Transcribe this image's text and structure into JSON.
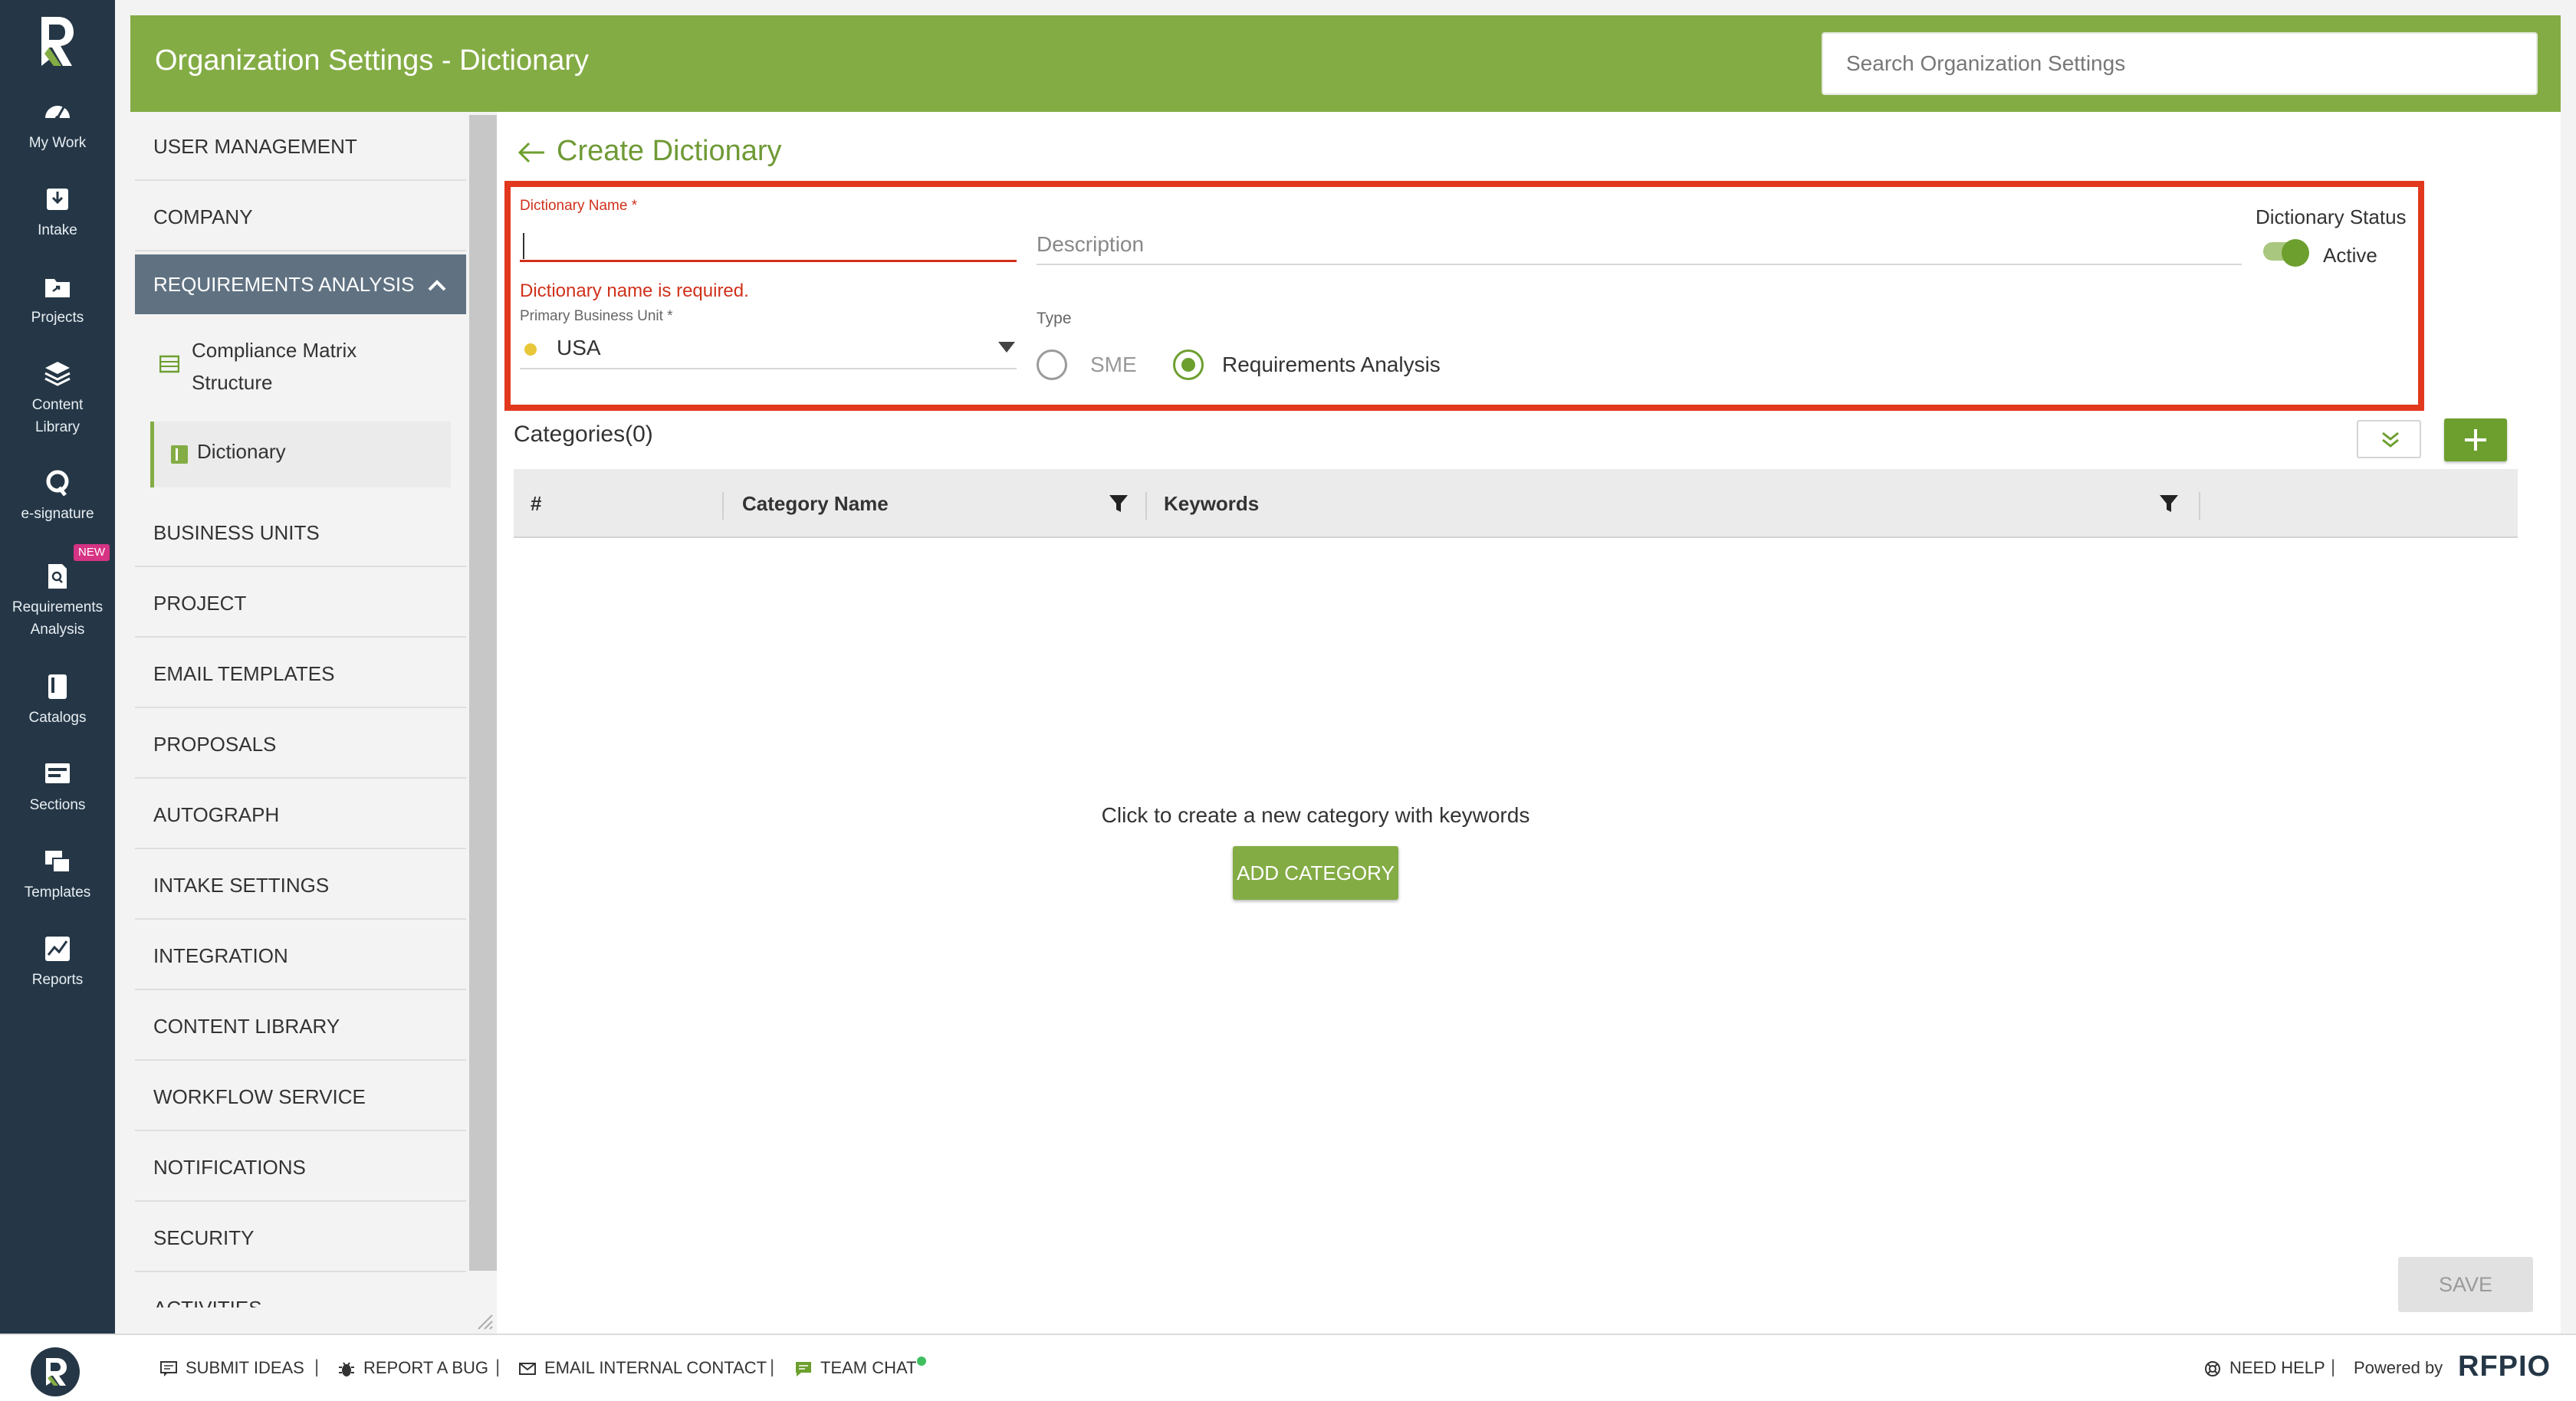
{
  "colors": {
    "nav_bg": "#253746",
    "header_bg": "#84ac45",
    "accent": "#6d9f2f",
    "error": "#d0311b",
    "highlight_border": "#e2381e",
    "badge": "#d63384"
  },
  "leftnav": {
    "items": [
      {
        "label": "My Work",
        "icon": "dashboard-icon"
      },
      {
        "label": "Intake",
        "icon": "download-tray-icon"
      },
      {
        "label": "Projects",
        "icon": "folder-icon"
      },
      {
        "label_line1": "Content",
        "label_line2": "Library",
        "icon": "layers-icon"
      },
      {
        "label": "e-signature",
        "icon": "signature-icon"
      },
      {
        "label_line1": "Requirements",
        "label_line2": "Analysis",
        "icon": "document-search-icon",
        "badge": "NEW"
      },
      {
        "label": "Catalogs",
        "icon": "book-icon"
      },
      {
        "label": "Sections",
        "icon": "sections-icon"
      },
      {
        "label": "Templates",
        "icon": "templates-icon"
      },
      {
        "label": "Reports",
        "icon": "chart-icon"
      }
    ]
  },
  "header": {
    "title": "Organization Settings - Dictionary",
    "search_placeholder": "Search Organization Settings"
  },
  "menu": {
    "items": [
      "USER MANAGEMENT",
      "COMPANY",
      "REQUIREMENTS ANALYSIS",
      "BUSINESS UNITS",
      "PROJECT",
      "EMAIL TEMPLATES",
      "PROPOSALS",
      "AUTOGRAPH",
      "INTAKE SETTINGS",
      "INTEGRATION",
      "CONTENT LIBRARY",
      "WORKFLOW SERVICE",
      "NOTIFICATIONS",
      "SECURITY",
      "ACTIVITIES"
    ],
    "sub_items": [
      {
        "line1": "Compliance Matrix",
        "line2": "Structure"
      },
      {
        "line1": "Dictionary"
      }
    ]
  },
  "form": {
    "back_label": "Create Dictionary",
    "name_label": "Dictionary Name",
    "name_value": "",
    "name_error": "Dictionary name is required.",
    "description_placeholder": "Description",
    "status_label": "Dictionary Status",
    "status_value": "Active",
    "status_on": true,
    "bu_label": "Primary Business Unit",
    "bu_value": "USA",
    "type_label": "Type",
    "type_options": [
      "SME",
      "Requirements Analysis"
    ],
    "type_selected": "Requirements Analysis",
    "required_mark": "*"
  },
  "categories": {
    "title": "Categories(0)",
    "columns": [
      "#",
      "Category Name",
      "Keywords"
    ],
    "rows": [],
    "empty_text": "Click to create a new category with keywords",
    "add_label": "ADD CATEGORY"
  },
  "save_label": "SAVE",
  "footer": {
    "links": [
      "SUBMIT IDEAS",
      "REPORT A BUG",
      "EMAIL INTERNAL CONTACT",
      "TEAM CHAT",
      "NEED HELP"
    ],
    "separator": "|",
    "powered_by": "Powered by",
    "brand": "RFPIO"
  }
}
